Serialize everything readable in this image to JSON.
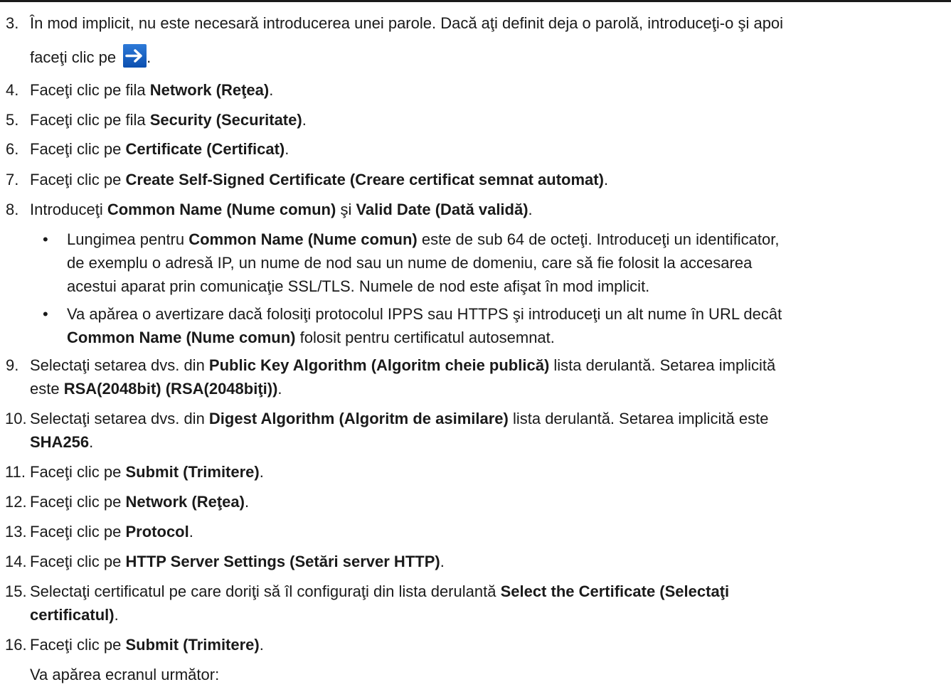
{
  "steps": [
    {
      "num": "3.",
      "line1": "În mod implicit, nu este necesară introducerea unei parole. Dacă aţi definit deja o parolă, introduceţi-o şi apoi",
      "line2_pre": "faceţi clic pe ",
      "line2_post": "."
    },
    {
      "num": "4.",
      "pre": "Faceţi clic pe fila ",
      "bold": "Network (Reţea)",
      "post": "."
    },
    {
      "num": "5.",
      "pre": "Faceţi clic pe fila ",
      "bold": "Security (Securitate)",
      "post": "."
    },
    {
      "num": "6.",
      "pre": "Faceţi clic pe ",
      "bold": "Certificate (Certificat)",
      "post": "."
    },
    {
      "num": "7.",
      "pre": "Faceţi clic pe ",
      "bold": "Create Self-Signed Certificate (Creare certificat semnat automat)",
      "post": "."
    },
    {
      "num": "8.",
      "pre": "Introduceţi ",
      "bold": "Common Name (Nume comun)",
      "mid": " şi ",
      "bold2": "Valid Date (Dată validă)",
      "post": "."
    },
    {
      "num": "9.",
      "pre": "Selectaţi setarea dvs. din ",
      "bold": "Public Key Algorithm (Algoritm cheie publică)",
      "post": " lista derulantă. Setarea implicită",
      "line2_pre": "este ",
      "line2_bold": "RSA(2048bit) (RSA(2048biţi))",
      "line2_post": "."
    },
    {
      "num": "10.",
      "pre": "Selectaţi setarea dvs. din ",
      "bold": "Digest Algorithm (Algoritm de asimilare)",
      "post": " lista derulantă. Setarea implicită este",
      "line2_bold": "SHA256",
      "line2_post": "."
    },
    {
      "num": "11.",
      "pre": "Faceţi clic pe ",
      "bold": "Submit (Trimitere)",
      "post": "."
    },
    {
      "num": "12.",
      "pre": "Faceţi clic pe ",
      "bold": "Network (Reţea)",
      "post": "."
    },
    {
      "num": "13.",
      "pre": "Faceţi clic pe ",
      "bold": "Protocol",
      "post": "."
    },
    {
      "num": "14.",
      "pre": "Faceţi clic pe ",
      "bold": "HTTP Server Settings (Setări server HTTP)",
      "post": "."
    },
    {
      "num": "15.",
      "pre": "Selectaţi certificatul pe care doriţi să îl configuraţi din lista derulantă ",
      "bold": "Select the Certificate (Selectaţi",
      "line2_bold": "certificatul)",
      "line2_post": "."
    },
    {
      "num": "16.",
      "pre": "Faceţi clic pe ",
      "bold": "Submit (Trimitere)",
      "post": ".",
      "line2": "Va apărea ecranul următor:"
    }
  ],
  "bullets": [
    {
      "dot": "•",
      "l1_pre": "Lungimea pentru ",
      "l1_bold": "Common Name (Nume comun)",
      "l1_post": " este de sub 64 de octeţi. Introduceţi un identificator,",
      "l2": "de exemplu o adresă IP, un nume de nod sau un nume de domeniu, care să fie folosit la accesarea",
      "l3": "acestui aparat prin comunicaţie SSL/TLS. Numele de nod este afişat în mod implicit."
    },
    {
      "dot": "•",
      "l1": "Va apărea o avertizare dacă folosiţi protocolul IPPS sau HTTPS şi introduceţi un alt nume în URL decât",
      "l2_bold": "Common Name (Nume comun)",
      "l2_post": " folosit pentru certificatul autosemnat."
    }
  ],
  "icons": {
    "next_arrow": "arrow-right-icon",
    "arrow_color": "#1a5fc4"
  }
}
